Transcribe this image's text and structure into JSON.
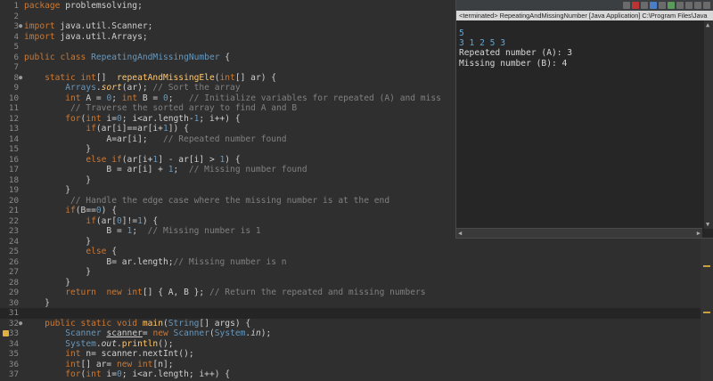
{
  "editor": {
    "lines": [
      {
        "n": "1",
        "fold": "",
        "html": "<span class='kw'>package</span> problemsolving;"
      },
      {
        "n": "2",
        "fold": "",
        "html": ""
      },
      {
        "n": "3",
        "fold": "●",
        "html": "<span class='kw'>import</span> java.util.Scanner;"
      },
      {
        "n": "4",
        "fold": "",
        "html": "<span class='kw'>import</span> java.util.Arrays;"
      },
      {
        "n": "5",
        "fold": "",
        "html": ""
      },
      {
        "n": "6",
        "fold": "",
        "html": "<span class='kw'>public</span> <span class='kw'>class</span> <span class='cls'>RepeatingAndMissingNumber</span> {"
      },
      {
        "n": "7",
        "fold": "",
        "html": ""
      },
      {
        "n": "8",
        "fold": "●",
        "html": "    <span class='kw'>static</span> <span class='kw'>int</span>[]  <span class='mth'>repeatAndMissingEle</span>(<span class='kw'>int</span>[] ar) {"
      },
      {
        "n": "9",
        "fold": "",
        "html": "        <span class='cls'>Arrays</span>.<span class='mth it'>sort</span>(ar); <span class='cm'>// Sort the array</span>"
      },
      {
        "n": "10",
        "fold": "",
        "html": "        <span class='kw'>int</span> A = <span class='num'>0</span>; <span class='kw'>int</span> B = <span class='num'>0</span>;   <span class='cm'>// Initialize variables for repeated (A) and miss</span>"
      },
      {
        "n": "11",
        "fold": "",
        "html": "         <span class='cm'>// Traverse the sorted array to find A and B</span>"
      },
      {
        "n": "12",
        "fold": "",
        "html": "        <span class='kw'>for</span>(<span class='kw'>int</span> i=<span class='num'>0</span>; i&lt;ar.length-<span class='num'>1</span>; i++) {"
      },
      {
        "n": "13",
        "fold": "",
        "html": "            <span class='kw'>if</span>(ar[i]==ar[i+<span class='num'>1</span>]) {"
      },
      {
        "n": "14",
        "fold": "",
        "html": "                A=ar[i];   <span class='cm'>// Repeated number found</span>"
      },
      {
        "n": "15",
        "fold": "",
        "html": "            }"
      },
      {
        "n": "16",
        "fold": "",
        "html": "            <span class='kw'>else</span> <span class='kw'>if</span>(ar[i+<span class='num'>1</span>] - ar[i] > <span class='num'>1</span>) {"
      },
      {
        "n": "17",
        "fold": "",
        "html": "                B = ar[i] + <span class='num'>1</span>;  <span class='cm'>// Missing number found</span>"
      },
      {
        "n": "18",
        "fold": "",
        "html": "            }"
      },
      {
        "n": "19",
        "fold": "",
        "html": "        }"
      },
      {
        "n": "20",
        "fold": "",
        "html": "         <span class='cm'>// Handle the edge case where the missing number is at the end</span>"
      },
      {
        "n": "21",
        "fold": "",
        "html": "        <span class='kw'>if</span>(B==<span class='num'>0</span>) {"
      },
      {
        "n": "22",
        "fold": "",
        "html": "            <span class='kw'>if</span>(ar[<span class='num'>0</span>]!=<span class='num'>1</span>) {"
      },
      {
        "n": "23",
        "fold": "",
        "html": "                B = <span class='num'>1</span>;  <span class='cm'>// Missing number is 1</span>"
      },
      {
        "n": "24",
        "fold": "",
        "html": "            }"
      },
      {
        "n": "25",
        "fold": "",
        "html": "            <span class='kw'>else</span> {"
      },
      {
        "n": "26",
        "fold": "",
        "html": "                B= ar.length;<span class='cm'>// Missing number is n</span>"
      },
      {
        "n": "27",
        "fold": "",
        "html": "            }"
      },
      {
        "n": "28",
        "fold": "",
        "html": "        }"
      },
      {
        "n": "29",
        "fold": "",
        "html": "        <span class='kw'>return</span>  <span class='kw'>new</span> <span class='kw'>int</span>[] { A, B }; <span class='cm'>// Return the repeated and missing numbers</span>"
      },
      {
        "n": "30",
        "fold": "",
        "html": "    }"
      },
      {
        "n": "31",
        "fold": "",
        "html": "",
        "current": true
      },
      {
        "n": "32",
        "fold": "●",
        "html": "    <span class='kw'>public</span> <span class='kw'>static</span> <span class='kw'>void</span> <span class='mth'>main</span>(<span class='cls'>String</span>[] args) {"
      },
      {
        "n": "33",
        "fold": "",
        "html": "        <span class='cls'>Scanner</span> <u>scanner</u>= <span class='kw'>new</span> <span class='cls'>Scanner</span>(<span class='cls'>System</span>.<span class='it'>in</span>);"
      },
      {
        "n": "34",
        "fold": "",
        "html": "        <span class='cls'>System</span>.<span class='it'>out</span>.<span class='mth'>println</span>();"
      },
      {
        "n": "35",
        "fold": "",
        "html": "        <span class='kw'>int</span> n= scanner.nextInt();"
      },
      {
        "n": "36",
        "fold": "",
        "html": "        <span class='kw'>int</span>[] ar= <span class='kw'>new</span> <span class='kw'>int</span>[n];"
      },
      {
        "n": "37",
        "fold": "",
        "html": "        <span class='kw'>for</span>(<span class='kw'>int</span> i=<span class='num'>0</span>; i&lt;ar.length; i++) {"
      }
    ]
  },
  "console": {
    "status": "<terminated> RepeatingAndMissingNumber [Java Application] C:\\Program Files\\Java",
    "lines": [
      {
        "text": "5",
        "kind": "input"
      },
      {
        "text": "3 1 2 5 3",
        "kind": "input"
      },
      {
        "text": "Repeated number (A): 3",
        "kind": "out"
      },
      {
        "text": "Missing number (B): 4",
        "kind": "out"
      }
    ]
  }
}
